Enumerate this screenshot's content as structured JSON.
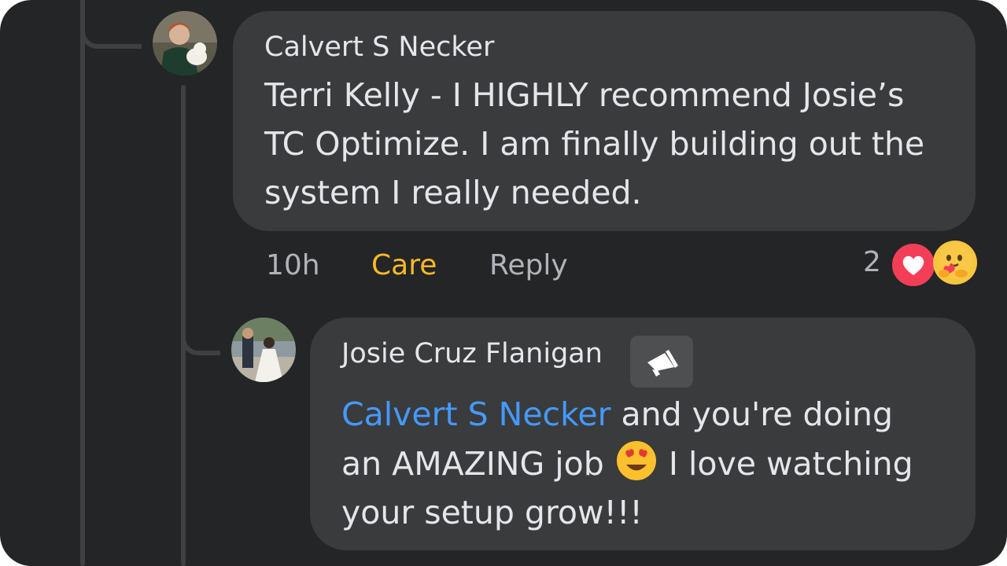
{
  "comment1": {
    "author": "Calvert S Necker",
    "text_lines": [
      "Terri Kelly - I HIGHLY recommend Josie’s",
      "TC Optimize. I am finally building out the",
      "system I really needed."
    ],
    "time": "10h",
    "reaction_label": "Care",
    "reply_label": "Reply",
    "reaction_count": "2",
    "reaction_icons": [
      "heart-reaction-icon",
      "care-hug-reaction-icon"
    ]
  },
  "comment2": {
    "author": "Josie Cruz Flanigan",
    "badge_icon": "megaphone-icon",
    "mention": "Calvert S Necker",
    "line1_rest": " and you're doing",
    "line2_before": "an AMAZING job ",
    "emoji": "heart-eyes-emoji",
    "line2_after": " I love watching",
    "line3": "your setup grow!!!"
  },
  "colors": {
    "background": "#242526",
    "bubble": "#3a3b3c",
    "text": "#e4e6eb",
    "muted": "#b0b3b8",
    "mention": "#4599ff",
    "care": "#f7b928",
    "heart": "#f33e58"
  }
}
